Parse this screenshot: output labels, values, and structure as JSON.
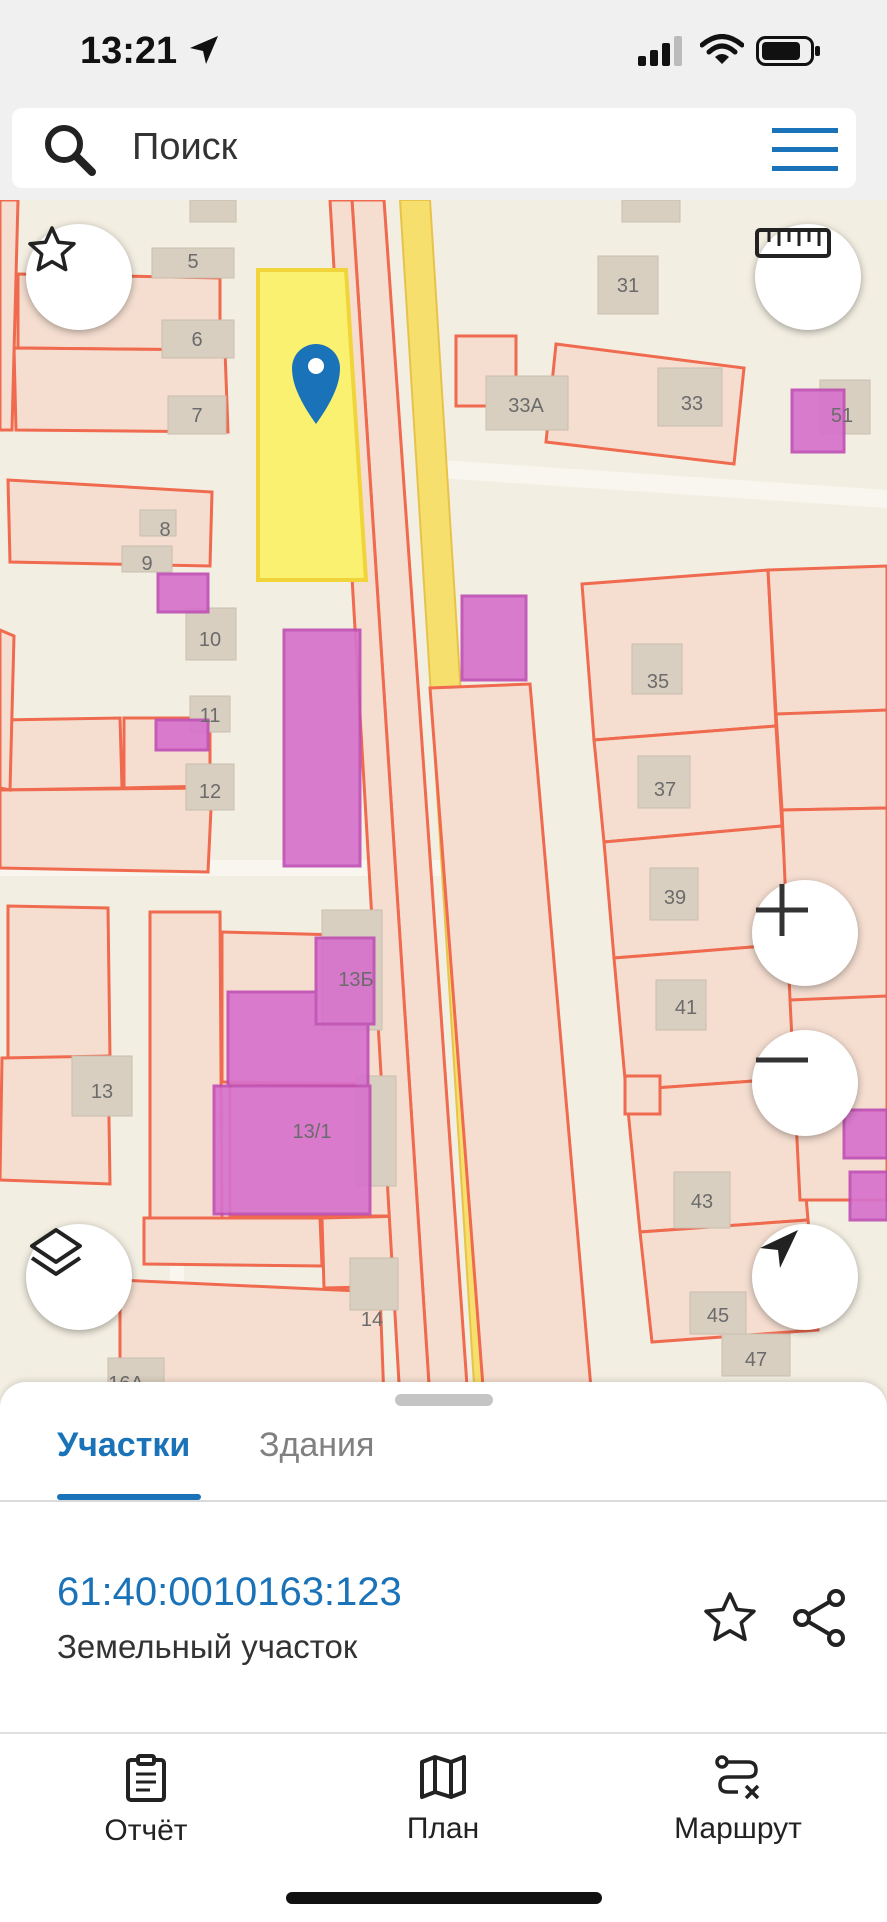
{
  "status_bar": {
    "time": "13:21"
  },
  "search": {
    "placeholder": "Поиск"
  },
  "map": {
    "house_numbers": [
      "5",
      "6",
      "7",
      "8",
      "9",
      "10",
      "11",
      "12",
      "13",
      "13Б",
      "13/1",
      "14",
      "16А",
      "31",
      "33",
      "33А",
      "51",
      "35",
      "37",
      "39",
      "41",
      "43",
      "45",
      "47"
    ],
    "colors": {
      "background": "#f3eee2",
      "parcel_fill": "#f5ded0",
      "parcel_border": "#ef6a4e",
      "building": "#d9cfc0",
      "selected_parcel": "#fbf171",
      "magenta": "#d772cc",
      "road": "#f6e27a",
      "pin": "#1a73b8"
    },
    "controls": [
      "star-icon",
      "ruler-icon",
      "zoom-in-icon",
      "zoom-out-icon",
      "layers-icon",
      "navigate-icon"
    ]
  },
  "sheet": {
    "tabs": [
      {
        "label": "Участки",
        "active": true
      },
      {
        "label": "Здания",
        "active": false
      }
    ],
    "parcel": {
      "cadastral_number": "61:40:0010163:123",
      "type": "Земельный участок"
    }
  },
  "bottom_nav": {
    "items": [
      {
        "label": "Отчёт",
        "icon": "report-icon"
      },
      {
        "label": "План",
        "icon": "map-icon"
      },
      {
        "label": "Маршрут",
        "icon": "route-icon"
      }
    ]
  }
}
